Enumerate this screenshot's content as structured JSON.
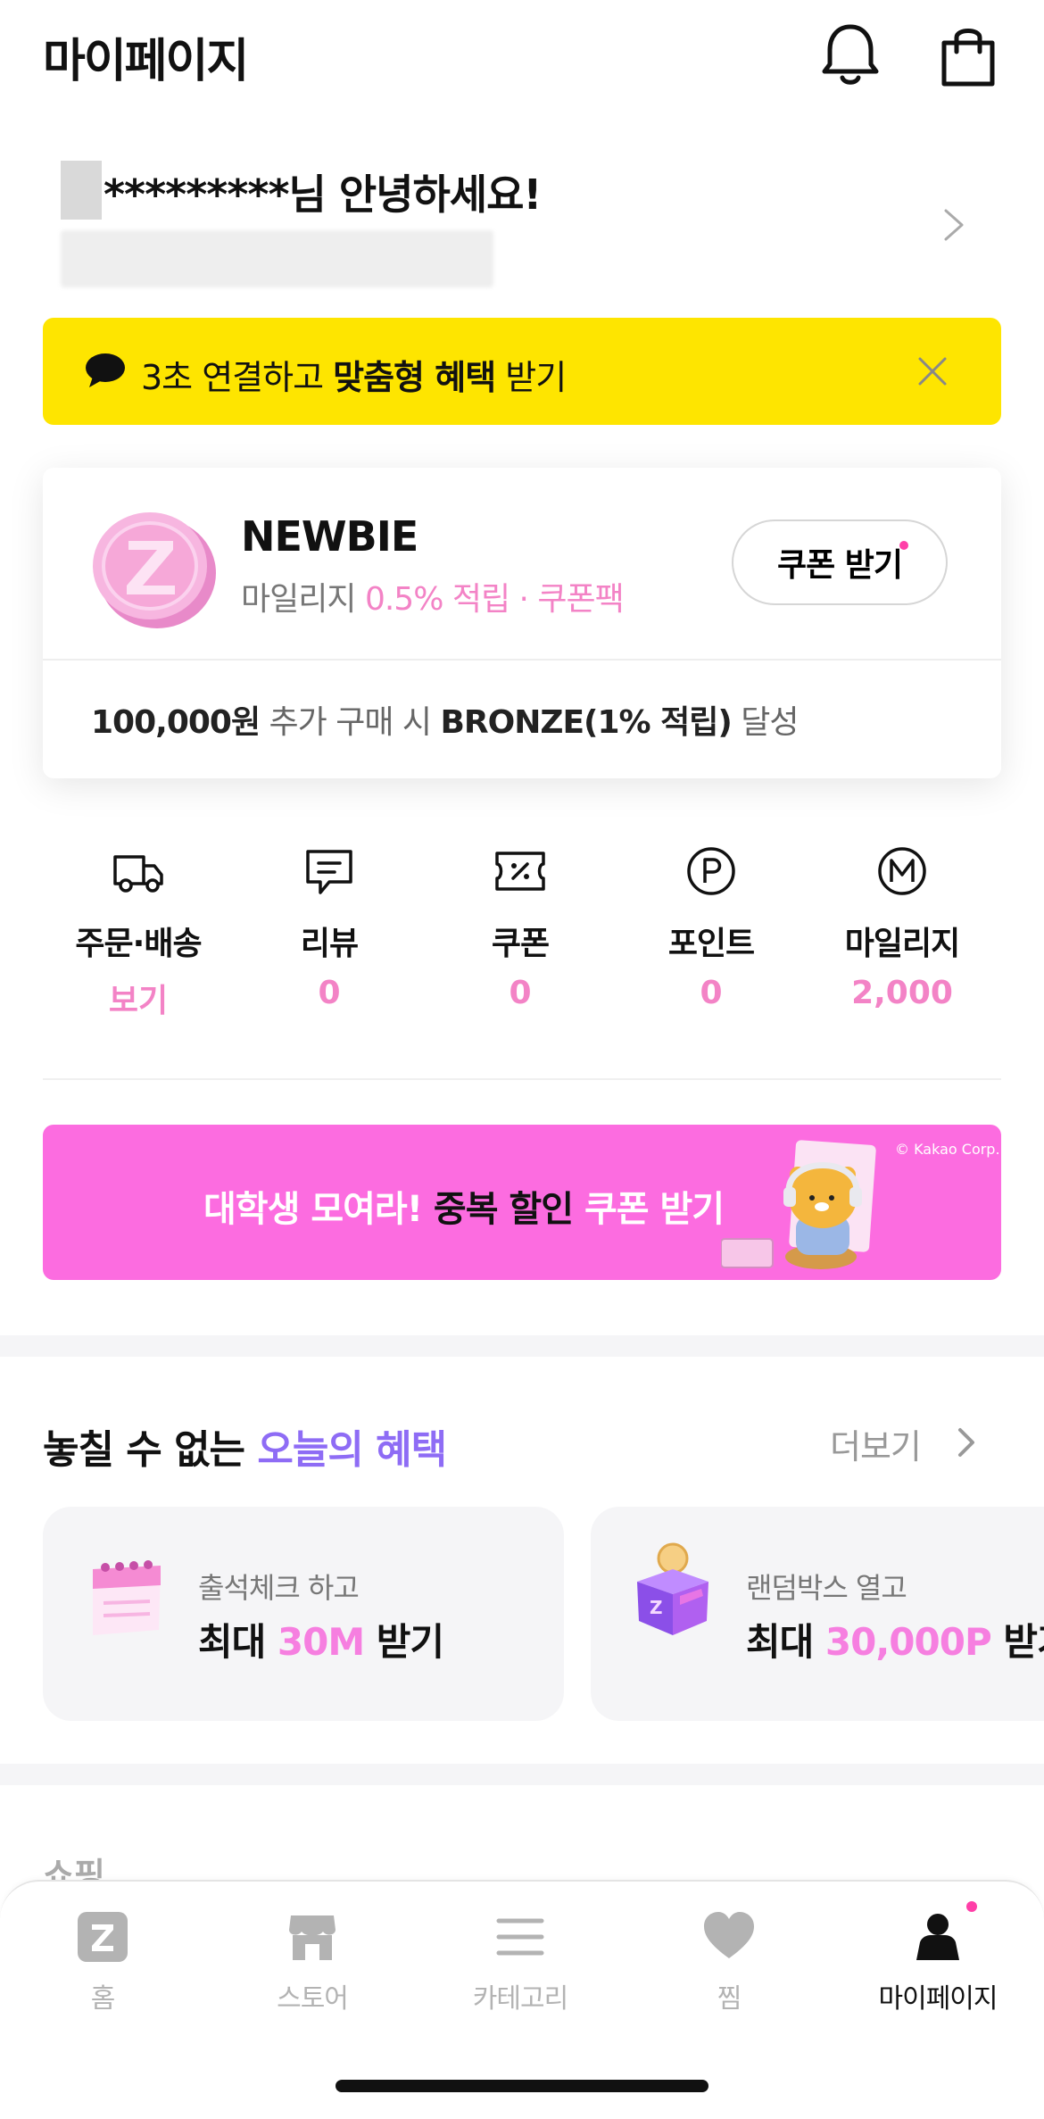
{
  "header": {
    "title": "마이페이지",
    "icons": [
      "bell-icon",
      "shopping-bag-icon"
    ]
  },
  "greeting": {
    "masked_name": "*********님 안녕하세요!"
  },
  "kakao_banner": {
    "text_prefix": "3초 연결하고 ",
    "text_bold": "맞춤형 혜택",
    "text_suffix": " 받기",
    "background": "#fee500"
  },
  "grade": {
    "name": "NEWBIE",
    "desc_prefix": "마일리지 ",
    "desc_highlight": "0.5% 적립 · 쿠폰팩",
    "coupon_button": "쿠폰 받기",
    "next_amount": "100,000원",
    "next_mid": " 추가 구매 시 ",
    "next_grade": "BRONZE(1% 적립)",
    "next_suffix": " 달성",
    "accent": "#f383c6"
  },
  "quick_menu": [
    {
      "label": "주문·배송",
      "value": "보기",
      "icon": "truck-icon"
    },
    {
      "label": "리뷰",
      "value": "0",
      "icon": "review-icon"
    },
    {
      "label": "쿠폰",
      "value": "0",
      "icon": "coupon-icon"
    },
    {
      "label": "포인트",
      "value": "0",
      "icon": "point-icon"
    },
    {
      "label": "마일리지",
      "value": "2,000",
      "icon": "mileage-icon"
    }
  ],
  "promo_banner": {
    "text_prefix": "대학생 모여라! ",
    "text_bold": "중복 할인",
    "text_suffix": " 쿠폰 받기",
    "copyright": "© Kakao Corp.",
    "background": "#fc6ce0"
  },
  "benefits": {
    "title_prefix": "놓칠 수 없는 ",
    "title_highlight": "오늘의 혜택",
    "more_label": "더보기",
    "cards": [
      {
        "sub": "출석체크 하고",
        "main_prefix": "최대 ",
        "main_highlight": "30M",
        "main_suffix": " 받기",
        "icon": "calendar-icon"
      },
      {
        "sub": "랜덤박스 열고",
        "main_prefix": "최대 ",
        "main_highlight": "30,000P",
        "main_suffix": " 받기",
        "icon": "gift-box-icon"
      }
    ]
  },
  "shopping_section_label": "쇼핑",
  "tabbar": {
    "tabs": [
      {
        "label": "홈",
        "icon": "home-z-icon",
        "active": false
      },
      {
        "label": "스토어",
        "icon": "store-icon",
        "active": false
      },
      {
        "label": "카테고리",
        "icon": "menu-icon",
        "active": false
      },
      {
        "label": "찜",
        "icon": "heart-icon",
        "active": false
      },
      {
        "label": "마이페이지",
        "icon": "person-icon",
        "active": true
      }
    ]
  }
}
